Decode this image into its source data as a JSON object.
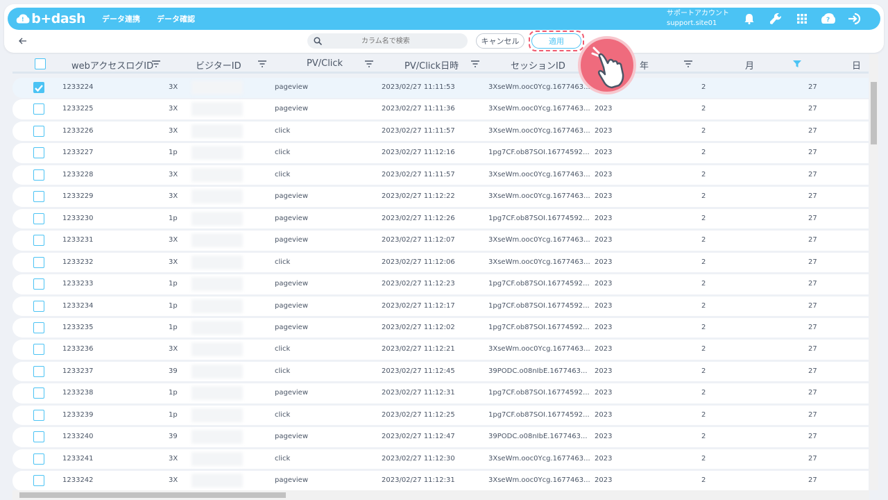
{
  "header": {
    "logo_text": "b+dash",
    "nav": [
      "データ連携",
      "データ確認"
    ],
    "account_line1": "サポートアカウント",
    "account_line2": "support.site01",
    "icons": [
      "bell-icon",
      "wrench-icon",
      "grid-icon",
      "chat-icon",
      "logout-icon"
    ],
    "accent_color": "#4bc3f4"
  },
  "toolbar": {
    "search_placeholder": "カラム名で検索",
    "cancel_label": "キャンセル",
    "apply_label": "適用",
    "highlight_color": "#ef5a6f"
  },
  "table": {
    "columns": [
      "webアクセスログID",
      "ビジターID",
      "PV/Click",
      "PV/Click日時",
      "セッションID",
      "年",
      "月",
      "日"
    ],
    "rows": [
      {
        "id": "1233224",
        "visitor": "3X",
        "type": "pageview",
        "time": "2023/02/27 11:11:53",
        "session": "3XseWm.ooc0Ycg.1677463...",
        "year": "",
        "month": "2",
        "day": "27",
        "checked": true
      },
      {
        "id": "1233225",
        "visitor": "3X",
        "type": "pageview",
        "time": "2023/02/27 11:11:36",
        "session": "3XseWm.ooc0Ycg.1677463...",
        "year": "2023",
        "month": "2",
        "day": "27",
        "checked": false
      },
      {
        "id": "1233226",
        "visitor": "3X",
        "type": "click",
        "time": "2023/02/27 11:11:57",
        "session": "3XseWm.ooc0Ycg.1677463...",
        "year": "2023",
        "month": "2",
        "day": "27",
        "checked": false
      },
      {
        "id": "1233227",
        "visitor": "1p",
        "type": "click",
        "time": "2023/02/27 11:12:16",
        "session": "1pg7CF.ob87SOI.16774592...",
        "year": "2023",
        "month": "2",
        "day": "27",
        "checked": false
      },
      {
        "id": "1233228",
        "visitor": "3X",
        "type": "click",
        "time": "2023/02/27 11:11:57",
        "session": "3XseWm.ooc0Ycg.1677463...",
        "year": "2023",
        "month": "2",
        "day": "27",
        "checked": false
      },
      {
        "id": "1233229",
        "visitor": "3X",
        "type": "pageview",
        "time": "2023/02/27 11:12:22",
        "session": "3XseWm.ooc0Ycg.1677463...",
        "year": "2023",
        "month": "2",
        "day": "27",
        "checked": false
      },
      {
        "id": "1233230",
        "visitor": "1p",
        "type": "pageview",
        "time": "2023/02/27 11:12:26",
        "session": "1pg7CF.ob87SOI.16774592...",
        "year": "2023",
        "month": "2",
        "day": "27",
        "checked": false
      },
      {
        "id": "1233231",
        "visitor": "3X",
        "type": "pageview",
        "time": "2023/02/27 11:12:07",
        "session": "3XseWm.ooc0Ycg.1677463...",
        "year": "2023",
        "month": "2",
        "day": "27",
        "checked": false
      },
      {
        "id": "1233232",
        "visitor": "3X",
        "type": "click",
        "time": "2023/02/27 11:12:06",
        "session": "3XseWm.ooc0Ycg.1677463...",
        "year": "2023",
        "month": "2",
        "day": "27",
        "checked": false
      },
      {
        "id": "1233233",
        "visitor": "1p",
        "type": "pageview",
        "time": "2023/02/27 11:12:23",
        "session": "1pg7CF.ob87SOI.16774592...",
        "year": "2023",
        "month": "2",
        "day": "27",
        "checked": false
      },
      {
        "id": "1233234",
        "visitor": "1p",
        "type": "pageview",
        "time": "2023/02/27 11:12:17",
        "session": "1pg7CF.ob87SOI.16774592...",
        "year": "2023",
        "month": "2",
        "day": "27",
        "checked": false
      },
      {
        "id": "1233235",
        "visitor": "1p",
        "type": "pageview",
        "time": "2023/02/27 11:12:02",
        "session": "1pg7CF.ob87SOI.16774592...",
        "year": "2023",
        "month": "2",
        "day": "27",
        "checked": false
      },
      {
        "id": "1233236",
        "visitor": "3X",
        "type": "click",
        "time": "2023/02/27 11:12:21",
        "session": "3XseWm.ooc0Ycg.1677463...",
        "year": "2023",
        "month": "2",
        "day": "27",
        "checked": false
      },
      {
        "id": "1233237",
        "visitor": "39",
        "type": "click",
        "time": "2023/02/27 11:12:45",
        "session": "39PODC.o08nIbE.1677463...",
        "year": "2023",
        "month": "2",
        "day": "27",
        "checked": false
      },
      {
        "id": "1233238",
        "visitor": "1p",
        "type": "pageview",
        "time": "2023/02/27 11:12:31",
        "session": "1pg7CF.ob87SOI.16774592...",
        "year": "2023",
        "month": "2",
        "day": "27",
        "checked": false
      },
      {
        "id": "1233239",
        "visitor": "1p",
        "type": "click",
        "time": "2023/02/27 11:12:25",
        "session": "1pg7CF.ob87SOI.16774592...",
        "year": "2023",
        "month": "2",
        "day": "27",
        "checked": false
      },
      {
        "id": "1233240",
        "visitor": "39",
        "type": "pageview",
        "time": "2023/02/27 11:12:47",
        "session": "39PODC.o08nIbE.1677463...",
        "year": "2023",
        "month": "2",
        "day": "27",
        "checked": false
      },
      {
        "id": "1233241",
        "visitor": "3X",
        "type": "click",
        "time": "2023/02/27 11:12:30",
        "session": "3XseWm.ooc0Ycg.1677463...",
        "year": "2023",
        "month": "2",
        "day": "27",
        "checked": false
      },
      {
        "id": "1233242",
        "visitor": "3X",
        "type": "pageview",
        "time": "2023/02/27 11:12:31",
        "session": "3XseWm.ooc0Ycg.1677463...",
        "year": "2023",
        "month": "2",
        "day": "27",
        "checked": false
      }
    ]
  }
}
